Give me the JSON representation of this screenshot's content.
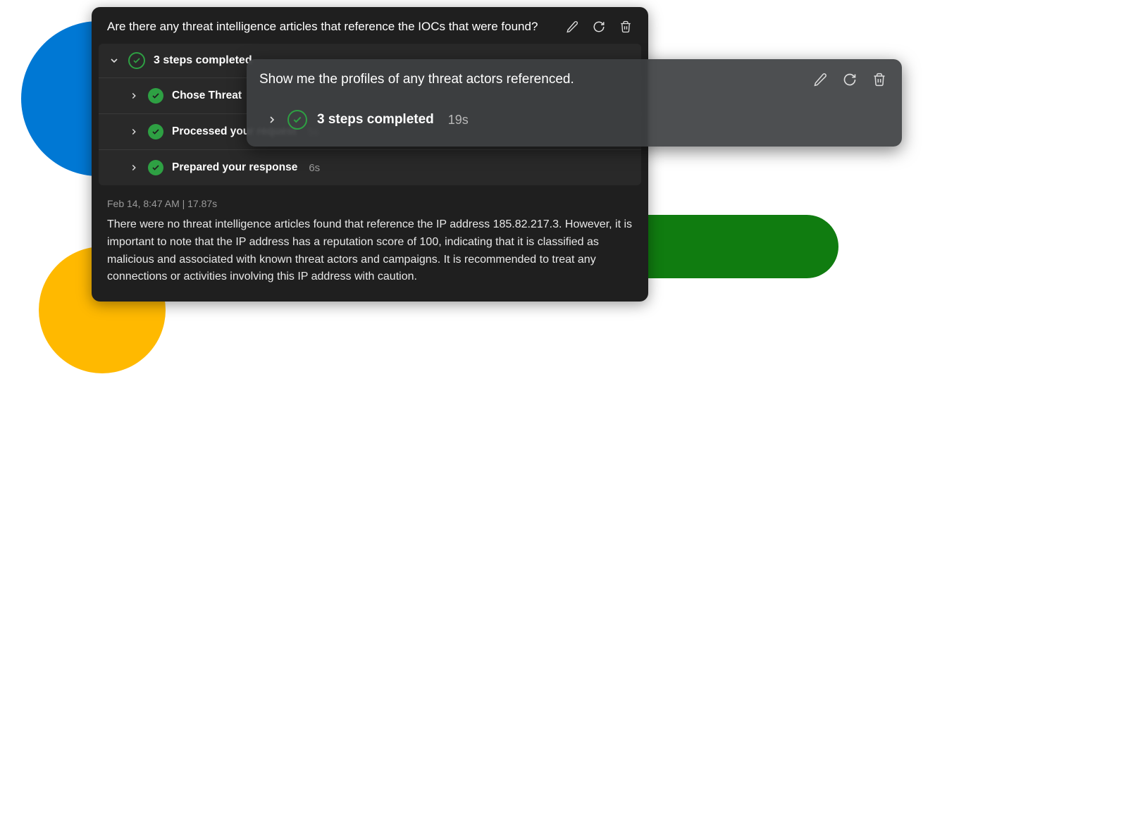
{
  "main_card": {
    "question": "Are there any threat intelligence articles that reference the IOCs that were found?",
    "steps_summary": "3 steps completed",
    "steps": [
      {
        "label": "Chose Threat",
        "time": ""
      },
      {
        "label": "Processed your request",
        "time": "5s"
      },
      {
        "label": "Prepared your response",
        "time": "6s"
      }
    ],
    "timestamp": "Feb 14, 8:47 AM  |  17.87s",
    "response": "There were no threat intelligence articles found that reference the IP address 185.82.217.3. However, it is important to note that the IP address has a reputation score of 100, indicating that it is classified as malicious and associated with known threat actors and campaigns. It is recommended to treat any connections or activities involving this IP address with caution."
  },
  "overlay_card": {
    "question": "Show me the profiles of any threat actors referenced.",
    "steps_summary": "3 steps completed",
    "steps_time": "19s"
  }
}
